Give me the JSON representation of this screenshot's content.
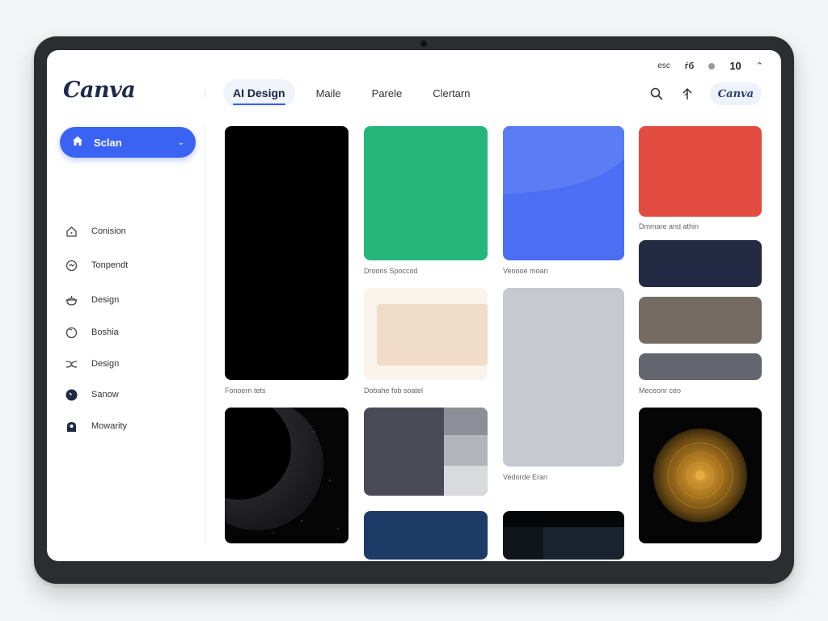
{
  "status": {
    "left_text": "esc",
    "icon_text": "ѓб",
    "number": "10"
  },
  "header": {
    "logo": "Canva",
    "tabs": [
      {
        "label": "AI Design",
        "active": true
      },
      {
        "label": "Maile",
        "active": false
      },
      {
        "label": "Parele",
        "active": false
      },
      {
        "label": "Clertarn",
        "active": false
      }
    ],
    "account_label": "Canva"
  },
  "sidebar": {
    "primary_button": "Sclan",
    "items": [
      {
        "label": "Conision",
        "icon": "home-outline-icon"
      },
      {
        "label": "Tonpendt",
        "icon": "template-icon"
      },
      {
        "label": "Design",
        "icon": "design-pot-icon"
      },
      {
        "label": "Boshia",
        "icon": "circle-icon"
      },
      {
        "label": "Design",
        "icon": "shuffle-icon"
      },
      {
        "label": "Sanow",
        "icon": "clock-filled-icon"
      },
      {
        "label": "Mowarity",
        "icon": "person-icon"
      }
    ]
  },
  "cards": {
    "c1": {
      "caption": "Fonoern tets",
      "color": "#000000"
    },
    "c2": {
      "caption": "Droons Spoccod",
      "color": "#25b67c"
    },
    "c3": {
      "caption": "Venooe moan",
      "color": "#4b6ef4"
    },
    "c4": {
      "caption": "Dmmare and athin",
      "color": "#e34c40"
    },
    "c5": {
      "color": "#252a44"
    },
    "c6": {
      "color": "#756b62"
    },
    "c7": {
      "caption": "Meceonr ceo",
      "color": "#63666f"
    },
    "c8": {
      "caption": "Dobahe fob soatel",
      "color": "#f5e1cf"
    },
    "c9": {
      "caption": "Vedorde Eran",
      "color": "#c6c9d0"
    },
    "c10": {
      "color": "#000000"
    },
    "c11": {
      "color": "#4a4a57"
    },
    "c12": {
      "color": "#1e3a66"
    },
    "c13": {
      "color": "#050608"
    },
    "c14": {
      "color": "#050505"
    }
  }
}
